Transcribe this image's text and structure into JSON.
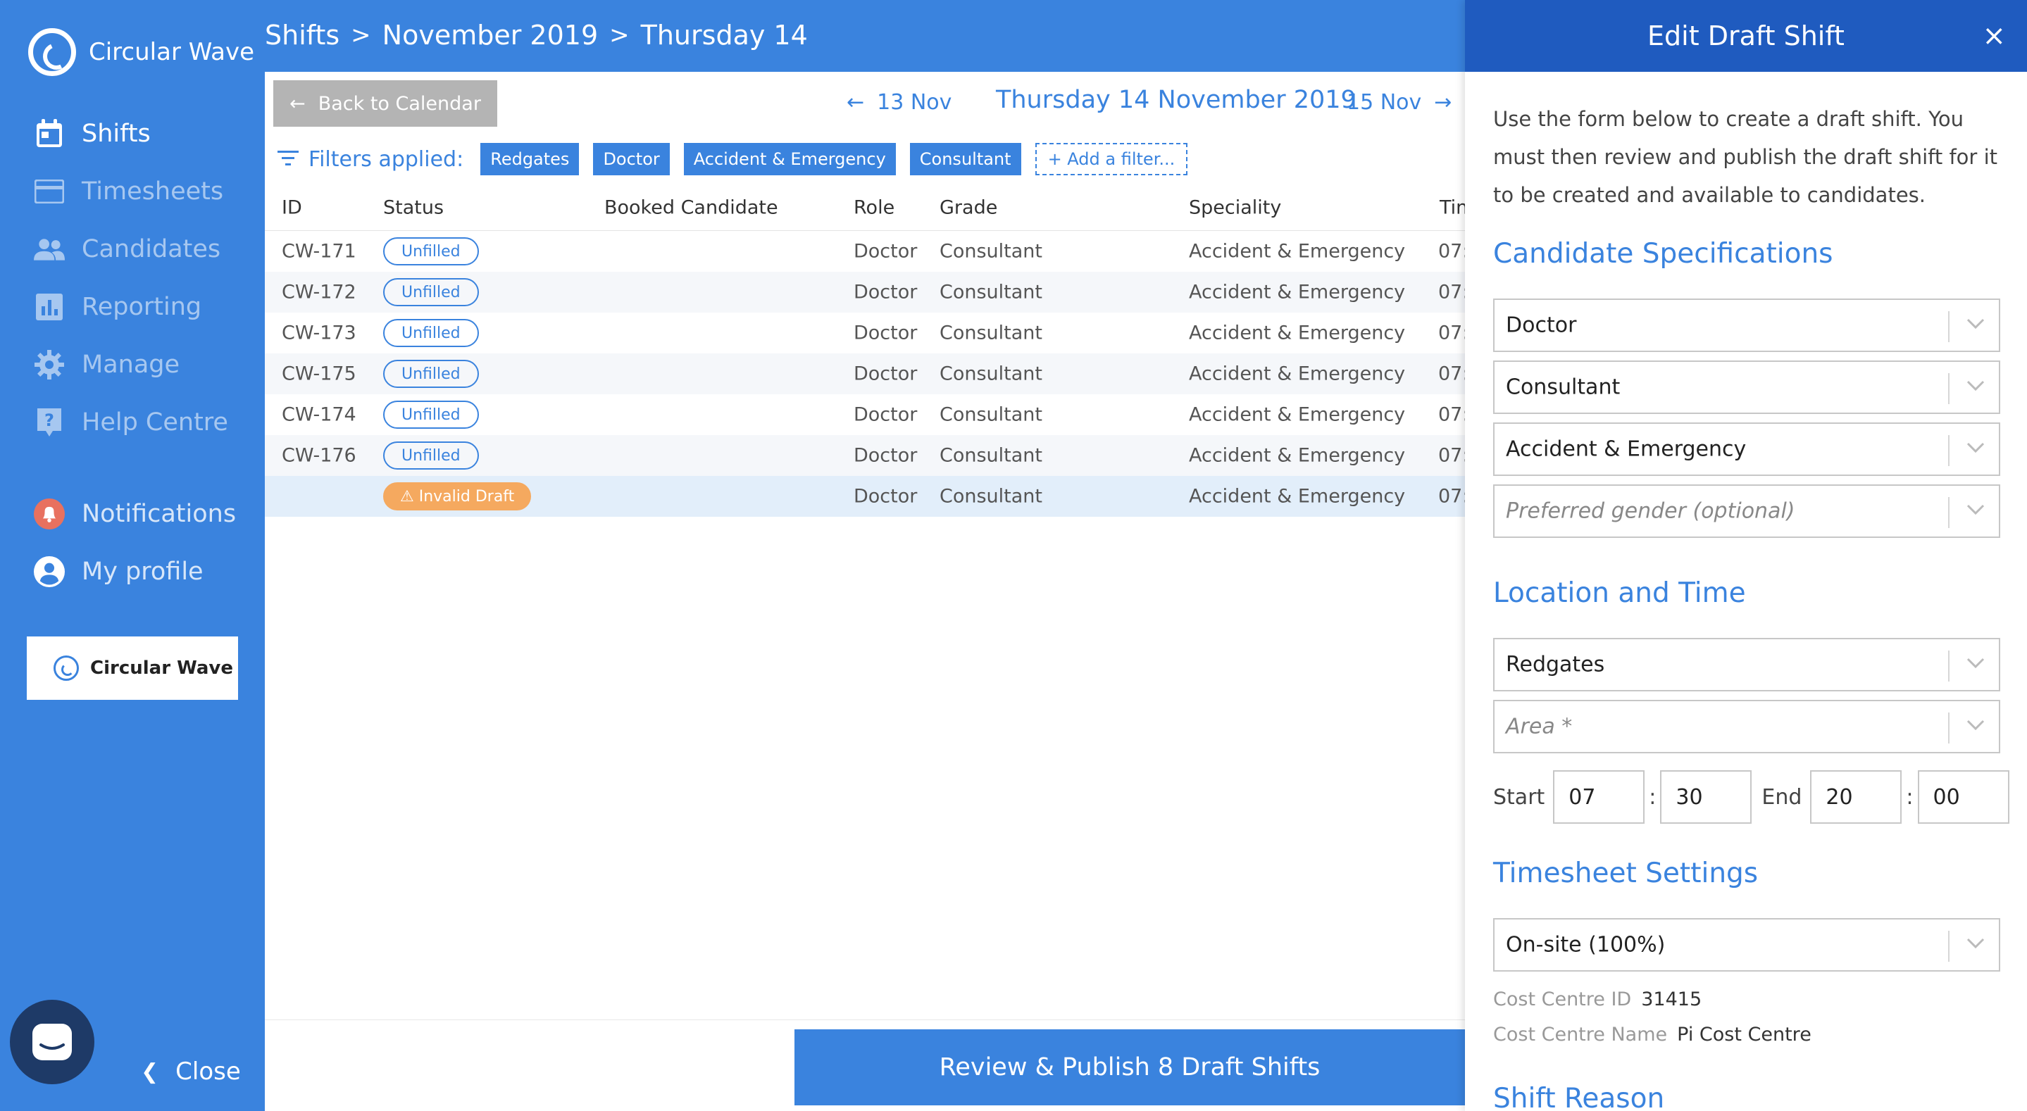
{
  "sidebar": {
    "brand": "Circular Wave",
    "nav": [
      {
        "label": "Shifts",
        "icon": "calendar-icon"
      },
      {
        "label": "Timesheets",
        "icon": "card-icon"
      },
      {
        "label": "Candidates",
        "icon": "people-icon"
      },
      {
        "label": "Reporting",
        "icon": "chart-icon"
      },
      {
        "label": "Manage",
        "icon": "gear-icon"
      },
      {
        "label": "Help Centre",
        "icon": "help-icon"
      },
      {
        "label": "Notifications",
        "icon": "bell-icon"
      },
      {
        "label": "My profile",
        "icon": "user-icon"
      }
    ],
    "org_card": "Circular Wave",
    "close_label": "Close"
  },
  "breadcrumb": [
    "Shifts",
    "November 2019",
    "Thursday 14"
  ],
  "toolbar": {
    "back_label": "Back to Calendar",
    "prev_label": "13 Nov",
    "date_title": "Thursday 14 November 2019",
    "next_label": "15 Nov"
  },
  "filters": {
    "label": "Filters applied:",
    "chips": [
      "Redgates",
      "Doctor",
      "Accident & Emergency",
      "Consultant"
    ],
    "add_label": "+ Add a filter..."
  },
  "table": {
    "columns": [
      "ID",
      "Status",
      "Booked Candidate",
      "Role",
      "Grade",
      "Speciality",
      "Tin"
    ],
    "rows": [
      {
        "id": "CW-171",
        "status": "Unfilled",
        "candidate": "",
        "role": "Doctor",
        "grade": "Consultant",
        "speciality": "Accident & Emergency",
        "time": "07:"
      },
      {
        "id": "CW-172",
        "status": "Unfilled",
        "candidate": "",
        "role": "Doctor",
        "grade": "Consultant",
        "speciality": "Accident & Emergency",
        "time": "07:"
      },
      {
        "id": "CW-173",
        "status": "Unfilled",
        "candidate": "",
        "role": "Doctor",
        "grade": "Consultant",
        "speciality": "Accident & Emergency",
        "time": "07:"
      },
      {
        "id": "CW-175",
        "status": "Unfilled",
        "candidate": "",
        "role": "Doctor",
        "grade": "Consultant",
        "speciality": "Accident & Emergency",
        "time": "07:"
      },
      {
        "id": "CW-174",
        "status": "Unfilled",
        "candidate": "",
        "role": "Doctor",
        "grade": "Consultant",
        "speciality": "Accident & Emergency",
        "time": "07:"
      },
      {
        "id": "CW-176",
        "status": "Unfilled",
        "candidate": "",
        "role": "Doctor",
        "grade": "Consultant",
        "speciality": "Accident & Emergency",
        "time": "07:"
      },
      {
        "id": "",
        "status": "⚠ Invalid Draft",
        "candidate": "",
        "role": "Doctor",
        "grade": "Consultant",
        "speciality": "Accident & Emergency",
        "time": "07:"
      }
    ]
  },
  "publish_label": "Review & Publish 8 Draft Shifts",
  "panel": {
    "title": "Edit Draft Shift",
    "close": "×",
    "intro": "Use the form below to create a draft shift. You must then review and publish the draft shift for it to be created and available to candidates.",
    "sections": {
      "candidate": "Candidate Specifications",
      "location": "Location and Time",
      "timesheet": "Timesheet Settings",
      "reason": "Shift Reason"
    },
    "fields": {
      "role": "Doctor",
      "grade": "Consultant",
      "speciality": "Accident & Emergency",
      "gender_placeholder": "Preferred gender (optional)",
      "site": "Redgates",
      "area_placeholder": "Area *",
      "timesheet": "On-site (100%)"
    },
    "time": {
      "start_label": "Start",
      "start_h": "07",
      "start_m": "30",
      "end_label": "End",
      "end_h": "20",
      "end_m": "00",
      "colon": ":"
    },
    "cost": {
      "id_label": "Cost Centre ID",
      "id_value": "31415",
      "name_label": "Cost Centre Name",
      "name_value": "Pi Cost Centre"
    }
  }
}
